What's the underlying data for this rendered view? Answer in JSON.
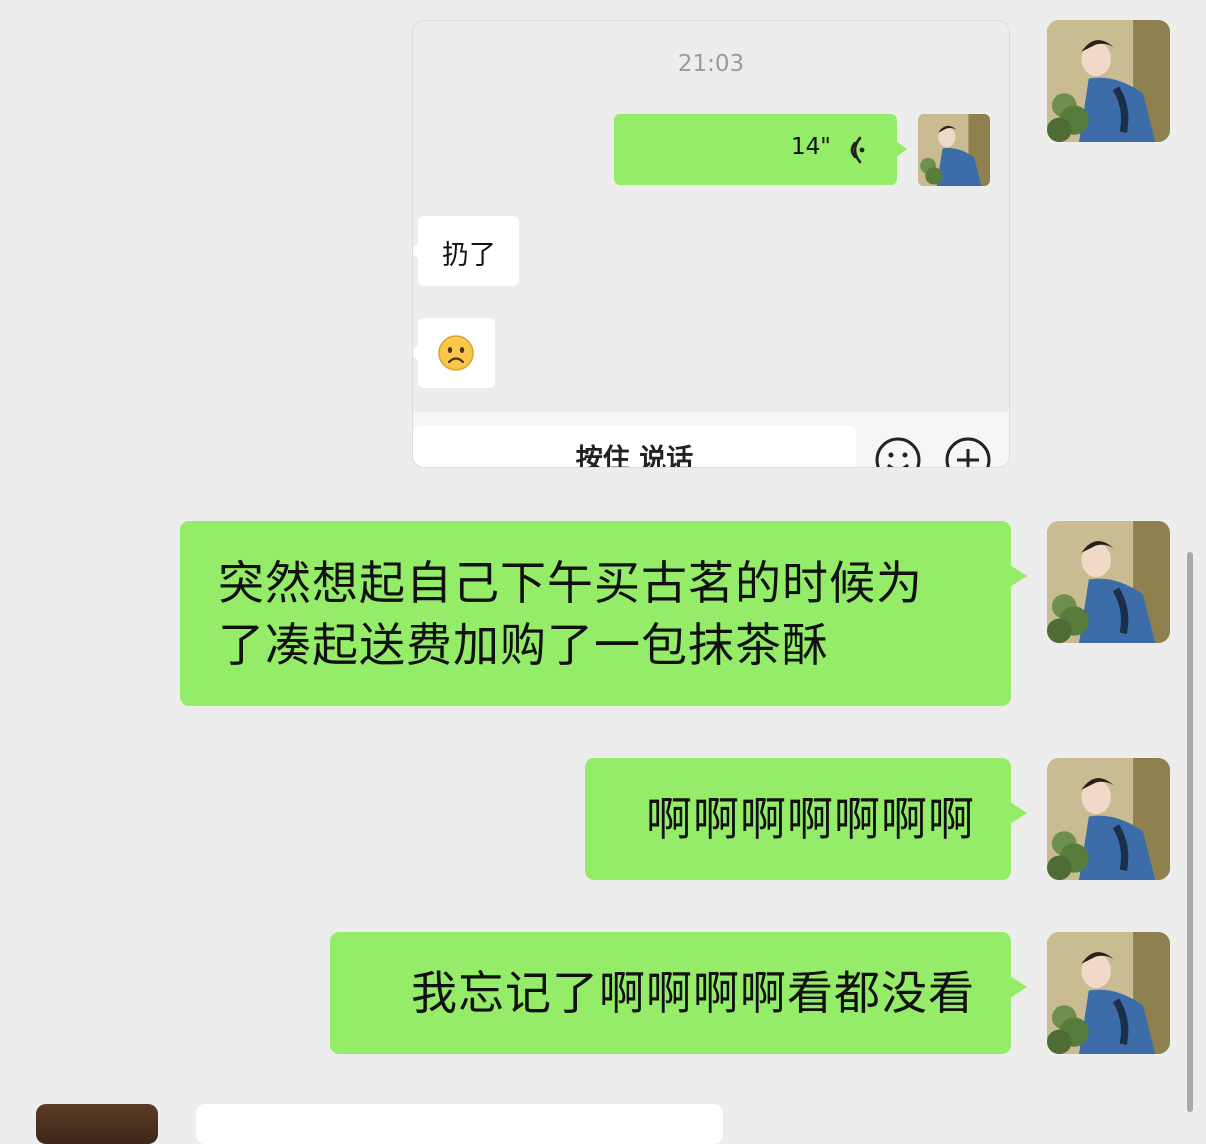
{
  "screenshot_card": {
    "timestamp": "21:03",
    "voice_message": {
      "duration": "14\"",
      "icon": "voice-wave-icon"
    },
    "incoming_messages": [
      {
        "text": "扔了"
      },
      {
        "emoji": "😟"
      }
    ],
    "input_bar": {
      "hold_to_talk_label": "按住 说话",
      "emoji_button_icon": "smiley-icon",
      "more_button_icon": "plus-circle-icon"
    }
  },
  "messages": [
    {
      "lines": [
        "突然想起自己下午买古茗的时候为",
        "了凑起送费加购了一包抹茶酥"
      ]
    },
    {
      "lines": [
        "啊啊啊啊啊啊啊"
      ]
    },
    {
      "lines": [
        "我忘记了啊啊啊啊看都没看"
      ]
    }
  ],
  "colors": {
    "background": "#ededed",
    "outgoing_bubble": "#95ec69",
    "incoming_bubble": "#ffffff",
    "timestamp_text": "#9b9b9b"
  }
}
